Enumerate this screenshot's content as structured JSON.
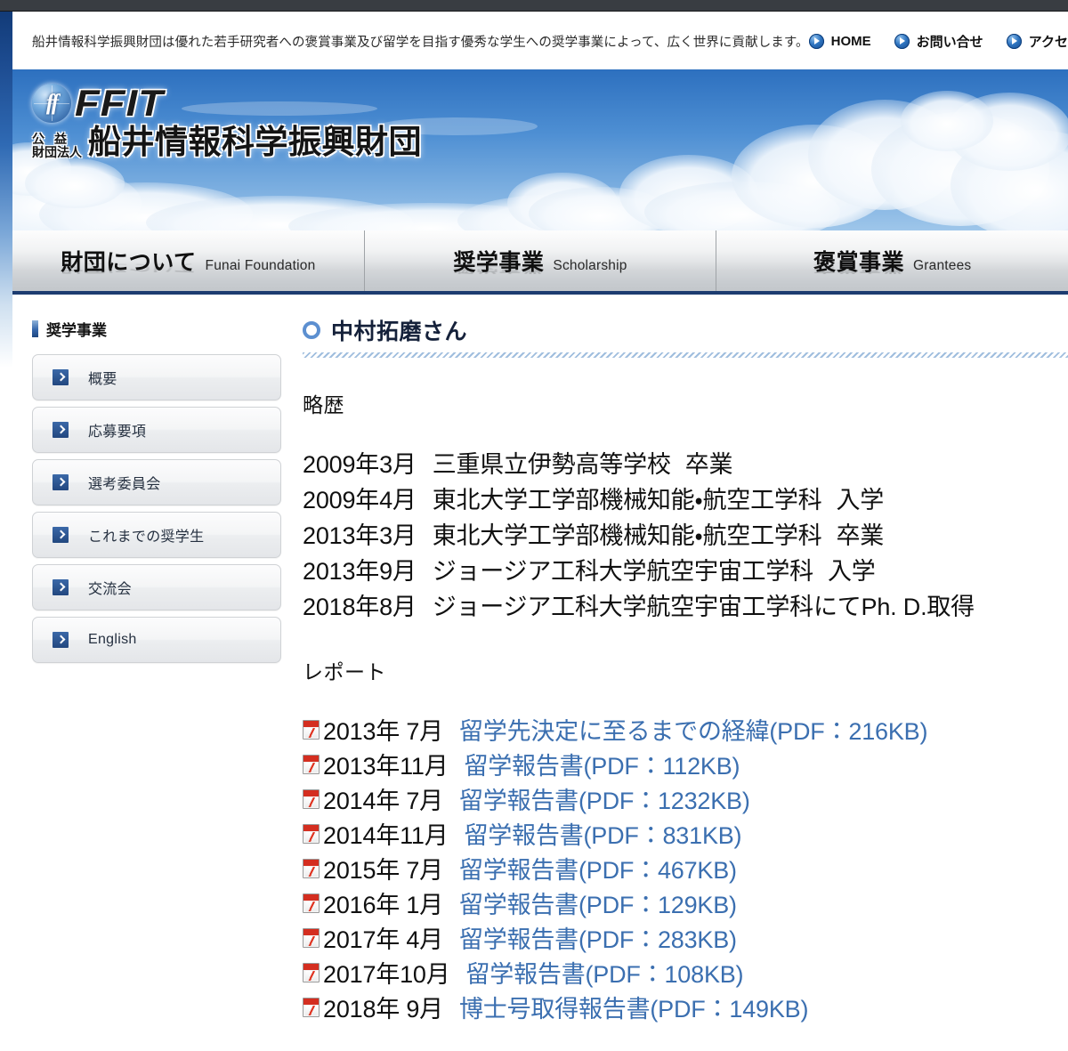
{
  "site": {
    "tagline": "船井情報科学振興財団は優れた若手研究者への褒賞事業及び留学を目指す優秀な学生への奨学事業によって、広く世界に貢献します。",
    "logo_mark": "FFIT",
    "logo_globe": "ff",
    "logo_prefix_top": "公益",
    "logo_prefix_bottom": "財団法人",
    "logo_name": "船井情報科学振興財団"
  },
  "utility_nav": [
    {
      "label": "HOME",
      "icon": "play-circle-icon"
    },
    {
      "label": "お問い合せ",
      "icon": "play-circle-icon"
    },
    {
      "label": "アクセス",
      "icon": "play-circle-icon"
    }
  ],
  "tabs": [
    {
      "ja": "財団について",
      "en": "Funai Foundation"
    },
    {
      "ja": "奨学事業",
      "en": "Scholarship"
    },
    {
      "ja": "褒賞事業",
      "en": "Grantees"
    }
  ],
  "sidebar": {
    "heading": "奨学事業",
    "items": [
      {
        "label": "概要"
      },
      {
        "label": "応募要項"
      },
      {
        "label": "選考委員会"
      },
      {
        "label": "これまでの奨学生"
      },
      {
        "label": "交流会"
      },
      {
        "label": "English"
      }
    ]
  },
  "main": {
    "page_title": "中村拓磨さん",
    "bio_heading": "略歴",
    "bio": [
      {
        "date": "2009年3月",
        "text": "三重県立伊勢高等学校",
        "status": "卒業"
      },
      {
        "date": "2009年4月",
        "text": "東北大学工学部機械知能・航空工学科",
        "status": "入学"
      },
      {
        "date": "2013年3月",
        "text": "東北大学工学部機械知能・航空工学科",
        "status": "卒業"
      },
      {
        "date": "2013年9月",
        "text": "ジョージア工科大学航空宇宙工学科",
        "status": "入学"
      },
      {
        "date": "2018年8月",
        "text": "ジョージア工科大学航空宇宙工学科にてPh. D.取得",
        "status": ""
      }
    ],
    "report_heading": "レポート",
    "reports": [
      {
        "date": "2013年 7月",
        "link": "留学先決定に至るまでの経緯(PDF：216KB)"
      },
      {
        "date": "2013年11月",
        "link": "留学報告書(PDF：112KB)"
      },
      {
        "date": "2014年 7月",
        "link": "留学報告書(PDF：1232KB)"
      },
      {
        "date": "2014年11月",
        "link": "留学報告書(PDF：831KB)"
      },
      {
        "date": "2015年 7月",
        "link": "留学報告書(PDF：467KB)"
      },
      {
        "date": "2016年 1月",
        "link": "留学報告書(PDF：129KB)"
      },
      {
        "date": "2017年 4月",
        "link": "留学報告書(PDF：283KB)"
      },
      {
        "date": "2017年10月",
        "link": "留学報告書(PDF：108KB)"
      },
      {
        "date": "2018年 9月",
        "link": "博士号取得報告書(PDF：149KB)"
      }
    ]
  },
  "colors": {
    "banner_blue": "#4d8ed2",
    "nav_underline": "#1c3c70",
    "link_blue": "#3b6fb0",
    "accent_blue": "#3567ab",
    "pdf_red": "#d42e20",
    "top_strip": "#393d42"
  }
}
